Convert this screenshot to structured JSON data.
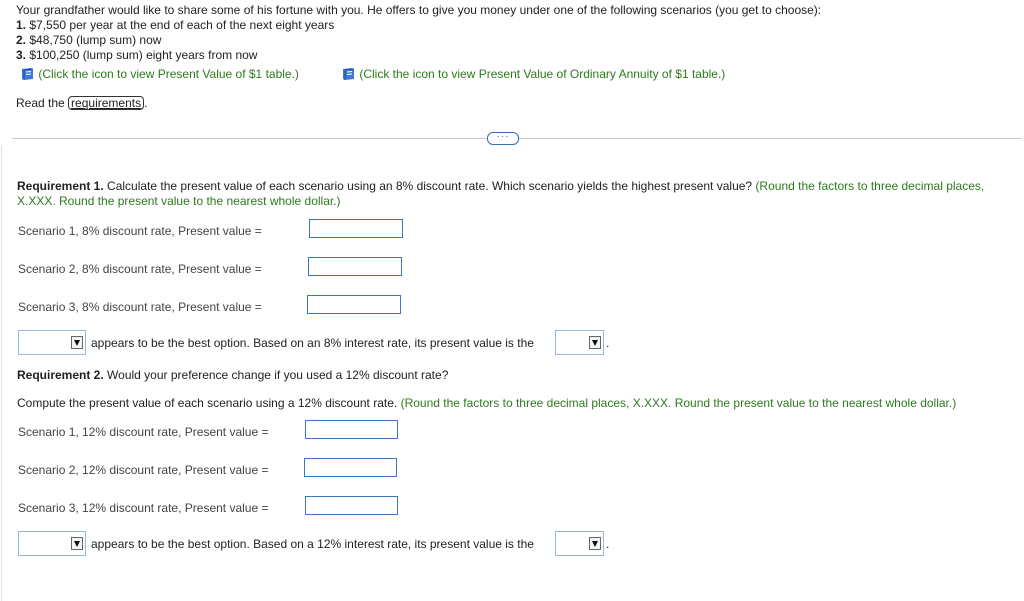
{
  "intro": {
    "question": "Your grandfather would like to share some of his fortune with you. He offers to give you money under one of the following scenarios (you get to choose):",
    "scenarios": [
      {
        "num": "1.",
        "text": "$7,550 per year at the end of each of the next eight years"
      },
      {
        "num": "2.",
        "text": "$48,750 (lump sum) now"
      },
      {
        "num": "3.",
        "text": "$100,250 (lump sum) eight years from now"
      }
    ],
    "links": [
      {
        "text": "(Click the icon to view Present Value of $1 table.)",
        "icon": "book-icon"
      },
      {
        "text": "(Click the icon to view Present Value of Ordinary Annuity of $1 table.)",
        "icon": "book-icon"
      }
    ],
    "read_prefix": "Read the",
    "requirements_link": "requirements",
    "read_suffix": "."
  },
  "more_button": "···",
  "req1": {
    "title": "Requirement 1.",
    "text": " Calculate the present value of each scenario using an 8% discount rate. Which scenario yields the highest present value?",
    "note_line1": " (Round the factors to three decimal places,",
    "note_line2": "X.XXX. Round the present value to the nearest whole dollar.)",
    "fields": [
      {
        "label": "Scenario 1, 8% discount rate, Present value =",
        "value": ""
      },
      {
        "label": "Scenario 2, 8% discount rate, Present value =",
        "value": ""
      },
      {
        "label": "Scenario 3, 8% discount rate, Present value =",
        "value": ""
      }
    ],
    "answer_text": "appears to be the best option. Based on an 8% interest rate, its present value is the",
    "answer_end": "."
  },
  "req2": {
    "title": "Requirement 2.",
    "text": " Would your preference change if you used a 12% discount rate?",
    "compute_text": "Compute the present value of each scenario using a 12% discount rate.",
    "note": " (Round the factors to three decimal places, X.XXX. Round the present value to the nearest whole dollar.)",
    "fields": [
      {
        "label": "Scenario 1, 12% discount rate, Present value =",
        "value": ""
      },
      {
        "label": "Scenario 2, 12% discount rate, Present value =",
        "value": ""
      },
      {
        "label": "Scenario 3, 12% discount rate, Present value =",
        "value": ""
      }
    ],
    "answer_text": "appears to be the best option. Based on a 12% interest rate, its present value is the",
    "answer_end": "."
  },
  "colors": {
    "accent": "#3a77bb",
    "note_green": "#2d7a1e"
  }
}
